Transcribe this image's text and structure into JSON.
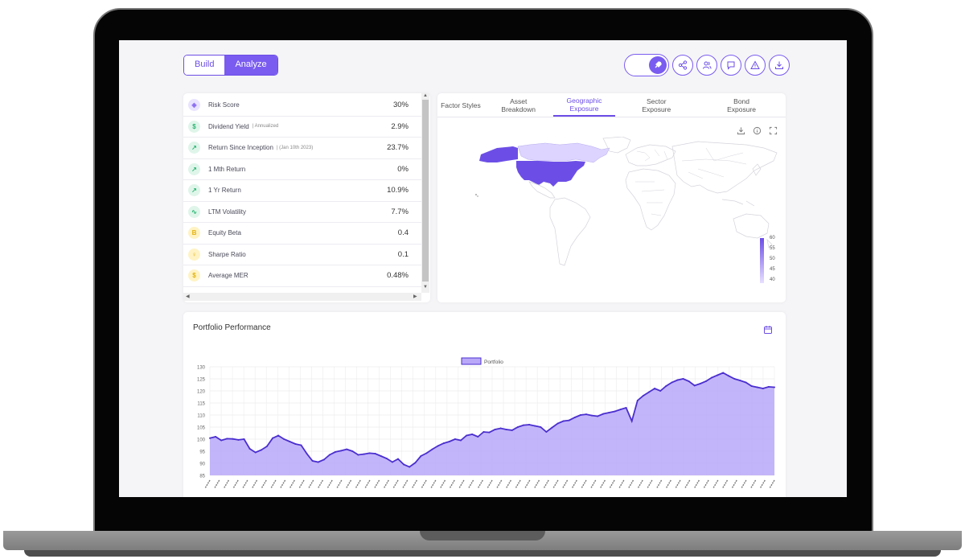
{
  "header": {
    "tabs": [
      {
        "label": "Build",
        "active": false
      },
      {
        "label": "Analyze",
        "active": true
      }
    ],
    "actions": [
      "rocket-icon",
      "share-icon",
      "users-icon",
      "comment-icon",
      "warning-icon",
      "download-icon"
    ]
  },
  "metrics": [
    {
      "label": "Risk Score",
      "sub": "",
      "value": "30%",
      "icon": "shield-icon",
      "color": "#8a6cf2",
      "bg": "#e9e3ff"
    },
    {
      "label": "Dividend Yield",
      "sub": "| Annualized",
      "value": "2.9%",
      "icon": "dollar-icon",
      "color": "#2bb673",
      "bg": "#dff5ea"
    },
    {
      "label": "Return Since Inception",
      "sub": "| (Jan 10th 2023)",
      "value": "23.7%",
      "icon": "trend-up-icon",
      "color": "#2bb673",
      "bg": "#dff5ea"
    },
    {
      "label": "1 Mth Return",
      "sub": "",
      "value": "0%",
      "icon": "trend-up-icon",
      "color": "#2bb673",
      "bg": "#dff5ea"
    },
    {
      "label": "1 Yr Return",
      "sub": "",
      "value": "10.9%",
      "icon": "trend-up-icon",
      "color": "#2bb673",
      "bg": "#dff5ea"
    },
    {
      "label": "LTM Volatility",
      "sub": "",
      "value": "7.7%",
      "icon": "activity-icon",
      "color": "#2bb673",
      "bg": "#dff5ea"
    },
    {
      "label": "Equity Beta",
      "sub": "",
      "value": "0.4",
      "icon": "beta-icon",
      "color": "#e2b20f",
      "bg": "#fff3c4"
    },
    {
      "label": "Sharpe Ratio",
      "sub": "",
      "value": "0.1",
      "icon": "bulb-icon",
      "color": "#e2b20f",
      "bg": "#fff3c4"
    },
    {
      "label": "Average MER",
      "sub": "",
      "value": "0.48%",
      "icon": "dollar-icon",
      "color": "#e2b20f",
      "bg": "#fff3c4"
    }
  ],
  "exposure": {
    "tabs": [
      {
        "label": "Factor Styles",
        "active": false
      },
      {
        "label": "Asset Breakdown",
        "active": false
      },
      {
        "label": "Geographic Exposure",
        "active": true
      },
      {
        "label": "Sector Exposure",
        "active": false
      },
      {
        "label": "Bond Exposure",
        "active": false
      }
    ],
    "legend": [
      "60",
      "55",
      "50",
      "45",
      "40"
    ],
    "highlight_color": "#6c4ee6",
    "secondary_color": "#ddd4ff"
  },
  "performance": {
    "title": "Portfolio Performance"
  },
  "chart_data": {
    "type": "area",
    "title": "",
    "series": [
      {
        "name": "Portfolio",
        "color": "#7a5cf0",
        "values": [
          100.4,
          101,
          99.5,
          100.2,
          100.1,
          99.7,
          100,
          96,
          94.5,
          95.5,
          97,
          100.4,
          101.5,
          100,
          99,
          98,
          97.5,
          94,
          91,
          90.5,
          91.5,
          93.5,
          94.7,
          95.2,
          95.8,
          95,
          93.5,
          93.8,
          94.2,
          94,
          93,
          92,
          90.5,
          91.8,
          89.5,
          88.5,
          90.2,
          93,
          94.2,
          95.8,
          97.2,
          98.3,
          99,
          100,
          99.5,
          101.5,
          102,
          101,
          103,
          102.8,
          104,
          104.5,
          104,
          103.7,
          105,
          105.8,
          106,
          105.5,
          105,
          103,
          104.8,
          106.5,
          107.5,
          107.8,
          109,
          110,
          110.3,
          109.8,
          109.5,
          110.5,
          111,
          111.5,
          112.3,
          113,
          107.5,
          116,
          118,
          119.5,
          121,
          120,
          122,
          123.5,
          124.5,
          125,
          124,
          122.2,
          123,
          124,
          125.5,
          126.5,
          127.5,
          126.2,
          125,
          124.3,
          123.5,
          122,
          121.5,
          121,
          121.7,
          121.5
        ]
      }
    ],
    "ylim": [
      85,
      130
    ],
    "yticks": [
      130,
      125,
      120,
      115,
      110,
      105,
      100,
      95,
      90,
      85
    ],
    "legend_position": "top-center",
    "grid": true
  }
}
